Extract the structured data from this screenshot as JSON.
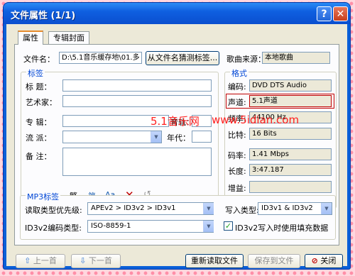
{
  "window": {
    "title": "文件属性 (1/1)"
  },
  "titlebar_buttons": {
    "help": "?",
    "close": "✕"
  },
  "tabs": [
    {
      "label": "属性"
    },
    {
      "label": "专辑封面"
    }
  ],
  "file": {
    "name_label": "文件名：",
    "name_value": "D:\\5.1音乐缓存地\\01.多",
    "guess_button": "从文件名猜测标签...",
    "source_label": "歌曲来源：",
    "source_value": "本地歌曲"
  },
  "tags": {
    "group_title": "标签",
    "title_label": "标   题：",
    "artist_label": "艺术家：",
    "album_label": "专   辑：",
    "track_label": "音轨：",
    "genre_label": "流   派：",
    "year_label": "年代：",
    "comment_label": "备   注：",
    "toolbar": {
      "advanced": "高级",
      "trad": "繁",
      "convert": "简",
      "case": "Aa"
    }
  },
  "format": {
    "group_title": "格式",
    "encoding_label": "编码:",
    "encoding_value": "DVD DTS Audio",
    "channels_label": "声道:",
    "channels_value": "5.1声道",
    "freq_label": "频率:",
    "freq_value": "44100 Hz",
    "bits_label": "比特:",
    "bits_value": "16 Bits",
    "bitrate_label": "码率:",
    "bitrate_value": "1.41 Mbps",
    "length_label": "长度:",
    "length_value": "3:47.187",
    "gain_label": "增益:",
    "gain_value": ""
  },
  "mp3": {
    "group_title": "MP3标签",
    "read_priority_label": "读取类型优先级:",
    "read_priority_value": "APEv2 > ID3v2 > ID3v1",
    "write_type_label": "写入类型:",
    "write_type_value": "ID3v1 & ID3v2",
    "id3_encoding_label": "ID3v2编码类型:",
    "id3_encoding_value": "ISO-8859-1",
    "padding_checkbox_label": "ID3v2写入时使用填充数据",
    "padding_checked": true
  },
  "buttons": {
    "prev": "上一首",
    "next": "下一首",
    "reload": "重新读取文件",
    "save": "保存到文件",
    "close": "关闭"
  },
  "watermark": {
    "left": "5.1音乐网",
    "right": "www.5idian.com"
  },
  "colors": {
    "title_bar": "#0a4fcf",
    "group_title": "#0046d5",
    "highlight_border": "#c00000",
    "watermark": "#ff2020"
  }
}
